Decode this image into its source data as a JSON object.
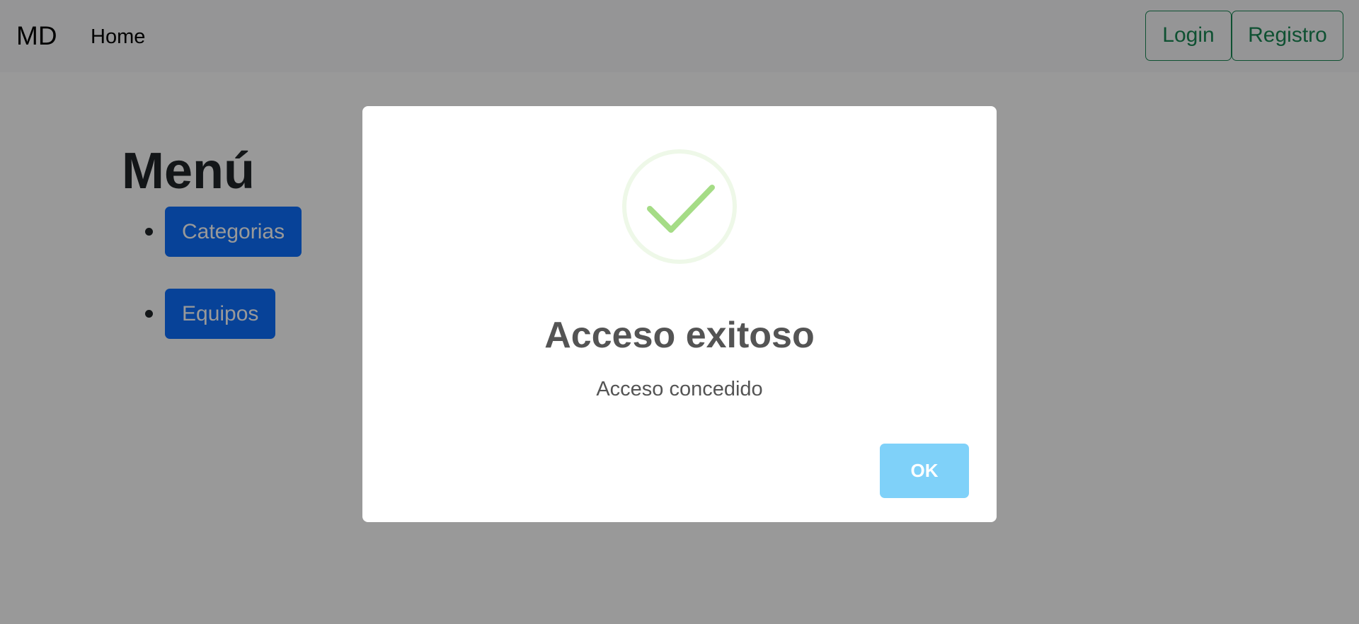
{
  "navbar": {
    "brand": "MD",
    "links": [
      {
        "label": "Home"
      }
    ],
    "buttons": {
      "login": "Login",
      "registro": "Registro"
    }
  },
  "main": {
    "title": "Menú",
    "items": [
      {
        "label": "Categorias"
      },
      {
        "label": "Equipos"
      }
    ]
  },
  "modal": {
    "icon": "success-check-icon",
    "title": "Acceso exitoso",
    "text": "Acceso concedido",
    "confirm_label": "OK"
  },
  "colors": {
    "primary": "#0d6efd",
    "success_outline": "#198754",
    "confirm_button": "#7fd1f9",
    "success_icon": "#a5dc86",
    "overlay": "rgba(0,0,0,0.4)"
  }
}
